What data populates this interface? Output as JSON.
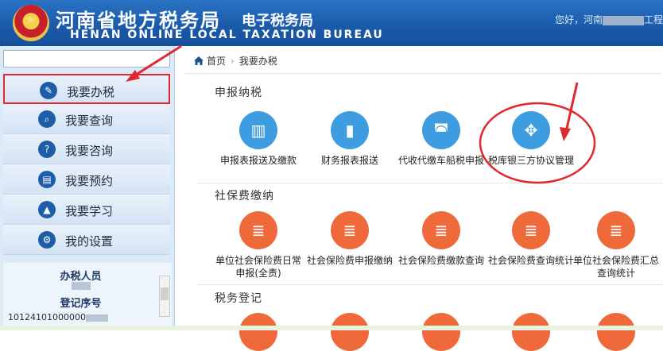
{
  "header": {
    "title_cn": "河南省地方税务局",
    "title_sub": "电子税务局",
    "title_en": "HENAN ONLINE LOCAL TAXATION BUREAU",
    "greeting_prefix": "您好，河南",
    "greeting_suffix": "工程"
  },
  "sidebar": {
    "search_value": "",
    "items": [
      {
        "label": "我要办税",
        "icon": "edit-icon",
        "glyph": "✎",
        "active": true
      },
      {
        "label": "我要查询",
        "icon": "search-icon",
        "glyph": "⌕"
      },
      {
        "label": "我要咨询",
        "icon": "question-icon",
        "glyph": "?"
      },
      {
        "label": "我要预约",
        "icon": "calendar-icon",
        "glyph": "▤"
      },
      {
        "label": "我要学习",
        "icon": "graduation-cap-icon",
        "glyph": "▲"
      },
      {
        "label": "我的设置",
        "icon": "gear-icon",
        "glyph": "⚙"
      }
    ],
    "info": {
      "person_label": "办税人员",
      "reg_label": "登记序号",
      "reg_number": "10124101000000"
    }
  },
  "breadcrumb": {
    "home": "首页",
    "current": "我要办税"
  },
  "sections": [
    {
      "title": "申报纳税",
      "tiles": [
        {
          "label": "申报表报送及缴款",
          "icon": "book-icon",
          "glyph": "▥"
        },
        {
          "label": "财务报表报送",
          "icon": "bar-chart-icon",
          "glyph": "▮"
        },
        {
          "label": "代收代缴车船税申报",
          "icon": "car-icon",
          "glyph": "◚"
        },
        {
          "label": "税库银三方协议管理",
          "icon": "move-arrows-icon",
          "glyph": "✥"
        }
      ]
    },
    {
      "title": "社保费缴纳",
      "tiles": [
        {
          "label": "单位社会保险费日常申报(全责)",
          "icon": "database-icon",
          "glyph": "≣"
        },
        {
          "label": "社会保险费申报缴纳",
          "icon": "database-icon",
          "glyph": "≣"
        },
        {
          "label": "社会保险费缴款查询",
          "icon": "database-icon",
          "glyph": "≣"
        },
        {
          "label": "社会保险费查询统计",
          "icon": "database-icon",
          "glyph": "≣"
        },
        {
          "label": "单位社会保险费汇总查询统计",
          "icon": "database-icon",
          "glyph": "≣"
        }
      ]
    },
    {
      "title": "税务登记",
      "tiles": []
    }
  ],
  "colors": {
    "header_blue": "#1a5aa8",
    "tile_blue": "#3d9de0",
    "tile_orange": "#ee6a3b",
    "annotation_red": "#e0282d"
  }
}
